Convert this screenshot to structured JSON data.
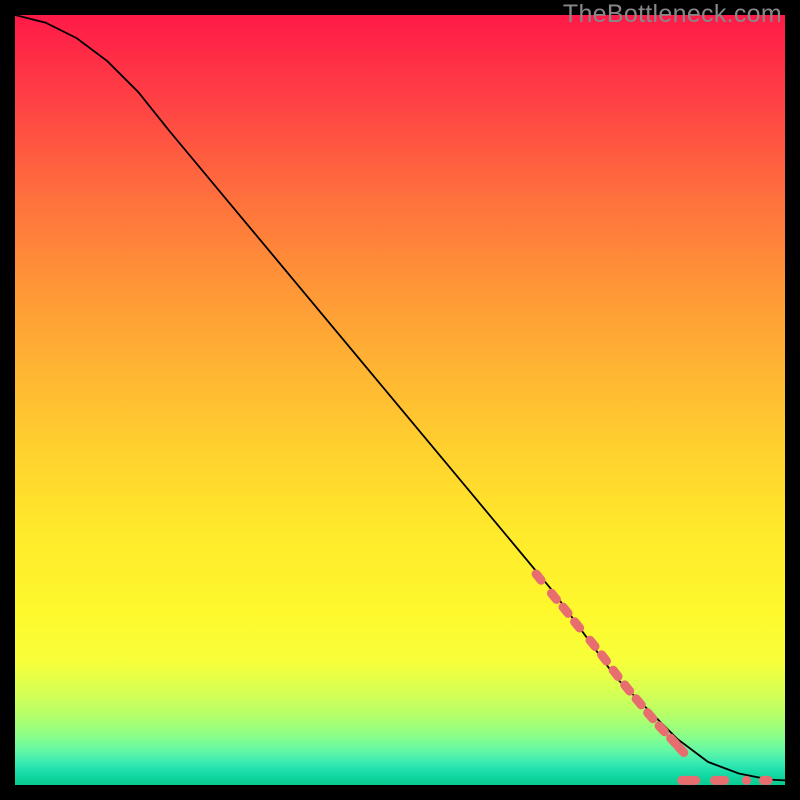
{
  "watermark": "TheBottleneck.com",
  "chart_data": {
    "type": "line",
    "title": "",
    "xlabel": "",
    "ylabel": "",
    "xlim": [
      0,
      100
    ],
    "ylim": [
      0,
      100
    ],
    "series": [
      {
        "name": "curve",
        "x": [
          0,
          4,
          8,
          12,
          16,
          20,
          30,
          40,
          50,
          60,
          70,
          78,
          82,
          86,
          90,
          94,
          98,
          100
        ],
        "y": [
          100,
          99,
          97,
          94,
          90,
          85,
          73,
          61,
          49,
          37,
          25,
          14,
          10,
          6,
          3,
          1.5,
          0.7,
          0.6
        ]
      }
    ],
    "curve_markers": {
      "note": "Pink oblong markers overlaid on curve between x≈68 and x≈87",
      "points": [
        {
          "x": 68.0,
          "y": 27.0
        },
        {
          "x": 70.0,
          "y": 24.5
        },
        {
          "x": 71.5,
          "y": 22.7
        },
        {
          "x": 73.0,
          "y": 20.8
        },
        {
          "x": 75.0,
          "y": 18.4
        },
        {
          "x": 76.5,
          "y": 16.5
        },
        {
          "x": 78.0,
          "y": 14.5
        },
        {
          "x": 79.5,
          "y": 12.6
        },
        {
          "x": 81.0,
          "y": 10.8
        },
        {
          "x": 82.5,
          "y": 9.0
        },
        {
          "x": 84.0,
          "y": 7.3
        },
        {
          "x": 85.5,
          "y": 5.7
        },
        {
          "x": 86.5,
          "y": 4.6
        }
      ]
    },
    "baseline_markers": {
      "note": "Pink dash clusters near y≈0.6 at far right",
      "clusters": [
        {
          "x": 87.5,
          "w": 3.0
        },
        {
          "x": 91.5,
          "w": 2.5
        },
        {
          "x": 95.0,
          "w": 1.2
        },
        {
          "x": 97.5,
          "w": 1.8
        }
      ],
      "y": 0.6
    }
  }
}
